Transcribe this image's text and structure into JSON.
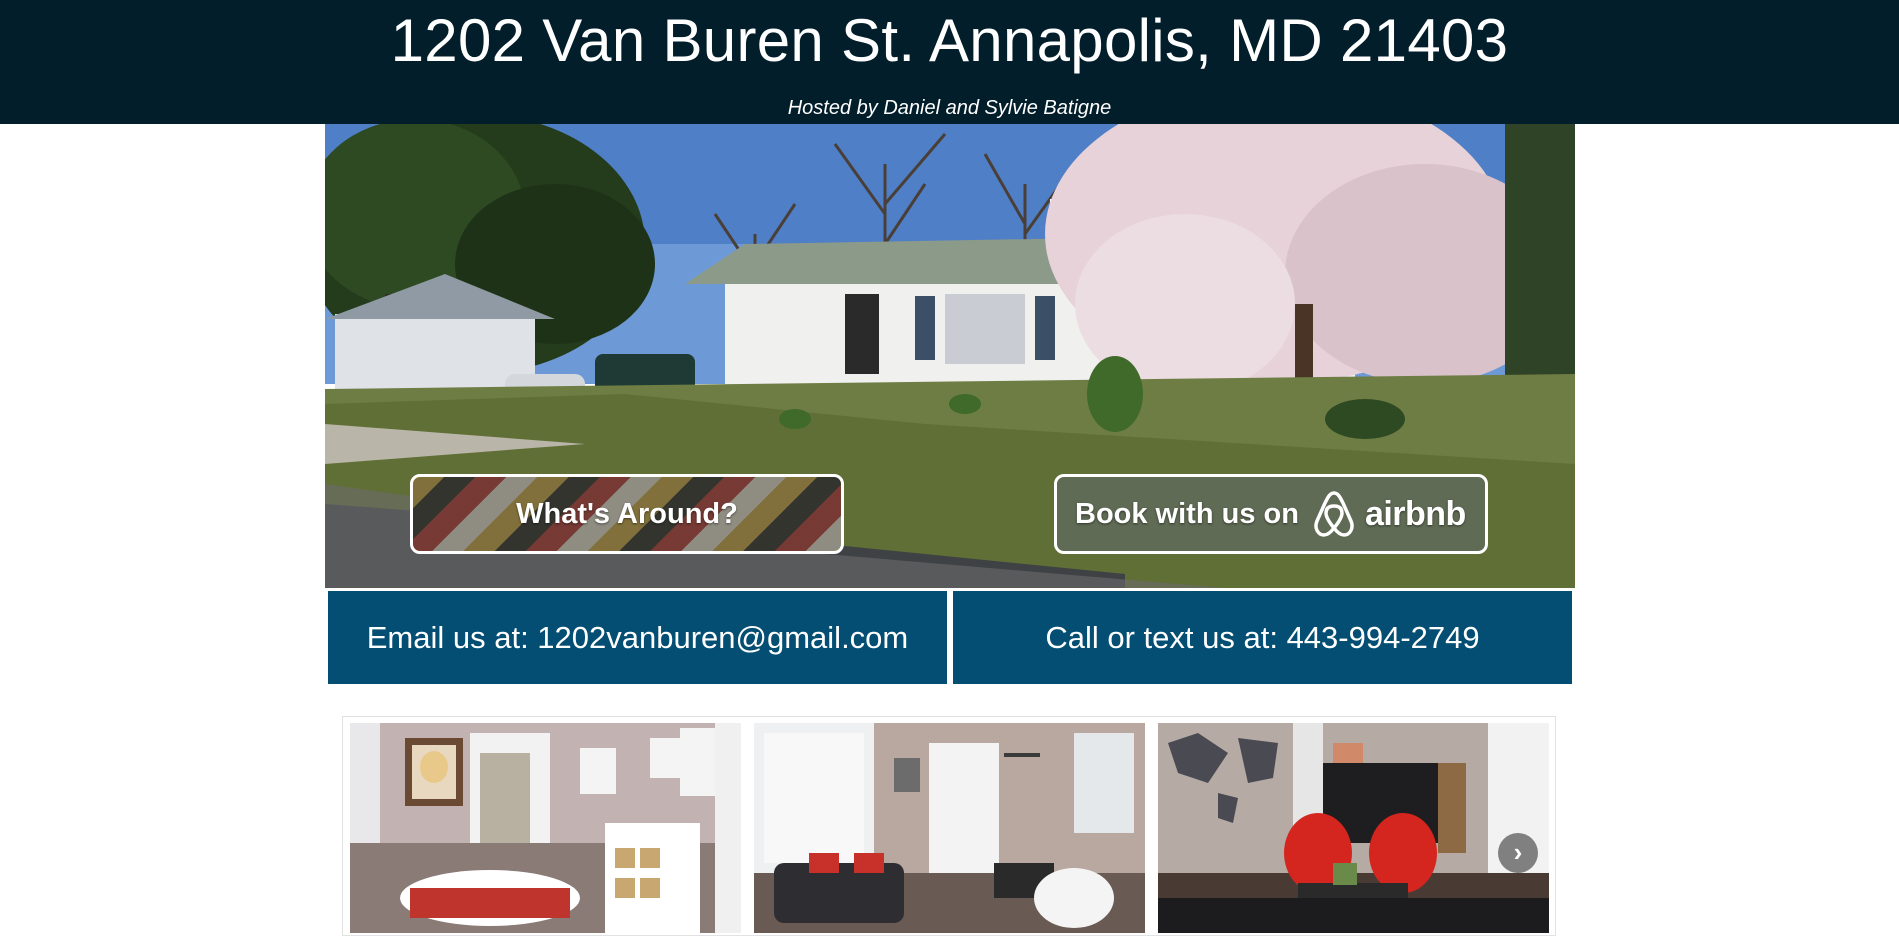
{
  "header": {
    "title": "1202 Van Buren St. Annapolis, MD 21403",
    "subtitle": "Hosted by Daniel and Sylvie Batigne"
  },
  "hero": {
    "whats_around_label": "What's Around?",
    "book_label": "Book with us on",
    "airbnb_wordmark": "airbnb",
    "airbnb_icon": "airbnb-logo-icon"
  },
  "contact": {
    "email_text": "Email us at: 1202vanburen@gmail.com",
    "phone_text": "Call or text us at: 443-994-2749"
  },
  "gallery": {
    "next_icon": "chevron-right-icon",
    "next_glyph": "›"
  },
  "colors": {
    "header_bg": "#031e2b",
    "contact_bg": "#034e72",
    "text": "#ffffff"
  }
}
